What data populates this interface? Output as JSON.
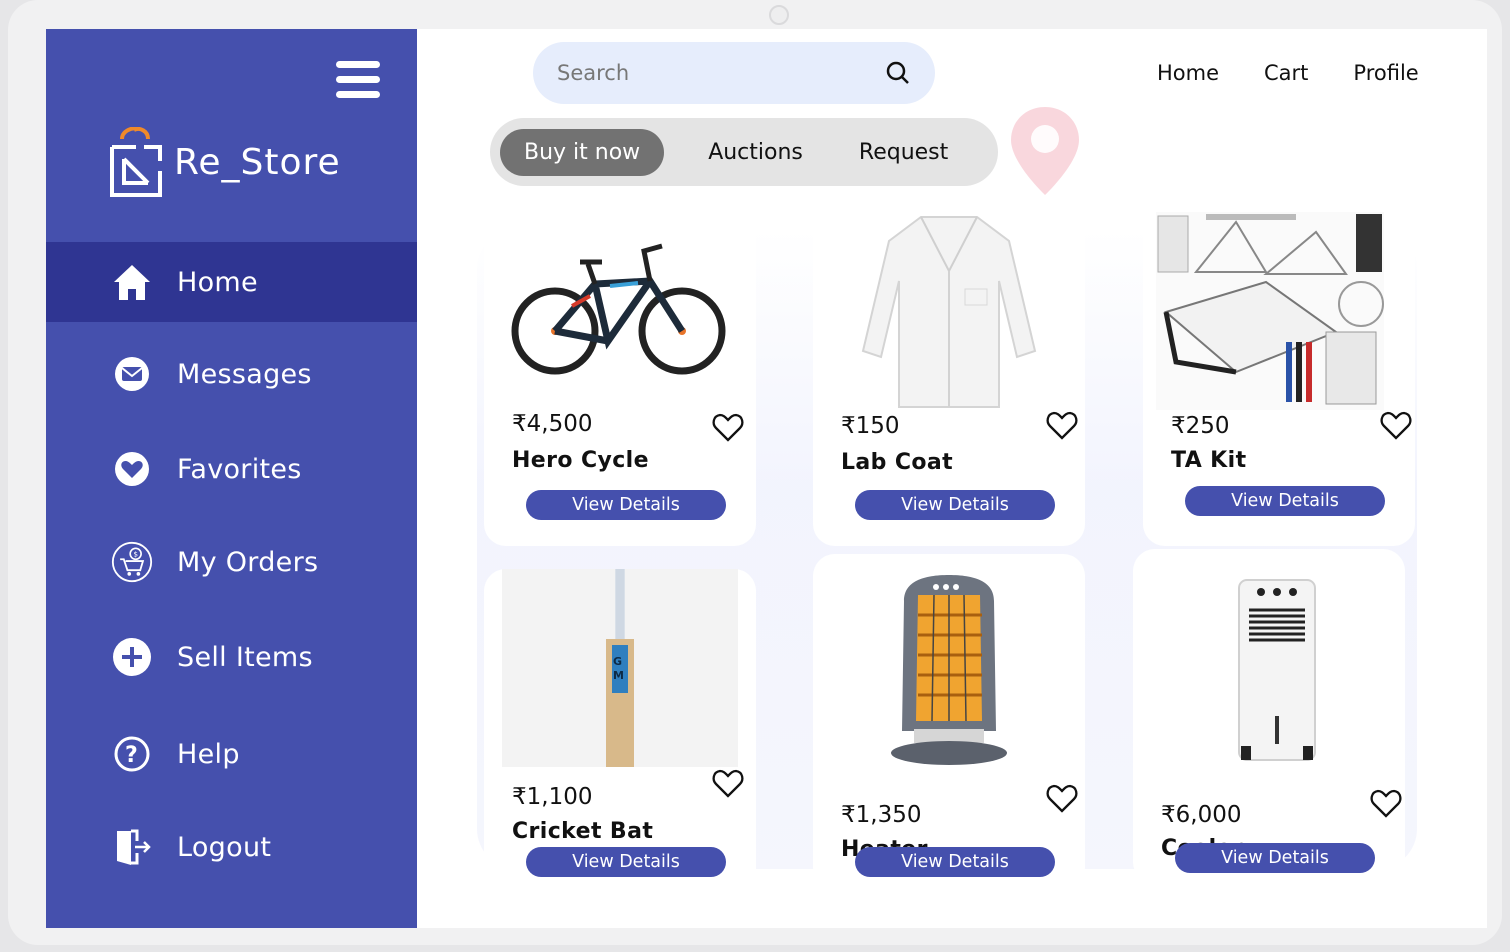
{
  "brand": {
    "name": "Re_Store",
    "accent": "#4550ad",
    "active_nav": "#2f3592"
  },
  "sidebar": {
    "items": [
      {
        "label": "Home",
        "icon": "home-icon",
        "active": true
      },
      {
        "label": "Messages",
        "icon": "envelope-icon",
        "active": false
      },
      {
        "label": "Favorites",
        "icon": "heart-icon",
        "active": false
      },
      {
        "label": "My Orders",
        "icon": "orders-icon",
        "active": false
      },
      {
        "label": "Sell Items",
        "icon": "plus-circle-icon",
        "active": false
      },
      {
        "label": "Help",
        "icon": "question-icon",
        "active": false
      },
      {
        "label": "Logout",
        "icon": "logout-door-icon",
        "active": false
      }
    ]
  },
  "search": {
    "placeholder": "Search"
  },
  "header": {
    "links": [
      "Home",
      "Cart",
      "Profile"
    ]
  },
  "tabs": [
    {
      "label": "Buy it now",
      "active": true
    },
    {
      "label": "Auctions",
      "active": false
    },
    {
      "label": "Request",
      "active": false
    }
  ],
  "products": [
    {
      "price": "₹4,500",
      "name": "Hero Cycle",
      "image": "bicycle",
      "button": "View Details"
    },
    {
      "price": "₹150",
      "name": "Lab Coat",
      "image": "lab-coat",
      "button": "View Details"
    },
    {
      "price": "₹250",
      "name": "TA Kit",
      "image": "drafting-kit",
      "button": "View Details"
    },
    {
      "price": "₹1,100",
      "name": "Cricket Bat",
      "image": "cricket-bat",
      "button": "View Details"
    },
    {
      "price": "₹1,350",
      "name": "Heater",
      "image": "heater",
      "button": "View Details"
    },
    {
      "price": "₹6,000",
      "name": "Cooler",
      "image": "air-cooler",
      "button": "View Details"
    }
  ]
}
